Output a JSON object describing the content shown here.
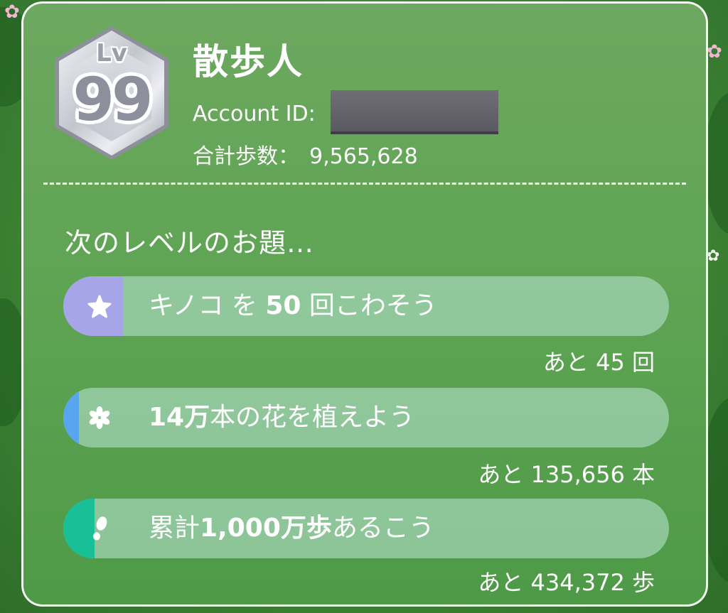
{
  "profile": {
    "level_label": "Lv",
    "level_value": "99",
    "name": "散歩人",
    "account_id_label": "Account ID:",
    "total_steps_label": "合計歩数：",
    "total_steps_value": "9,565,628"
  },
  "next_level": {
    "title": "次のレベルのお題…",
    "tasks": [
      {
        "icon": "star-icon",
        "accent_color": "#a5a5e8",
        "pre": "キノコ を ",
        "bold": "50",
        "post": " 回こわそう",
        "remaining": "あと 45 回"
      },
      {
        "icon": "flower-icon",
        "accent_color": "#5aa5f0",
        "pre": "",
        "bold": "14万",
        "post": "本の花を植えよう",
        "remaining": "あと 135,656 本"
      },
      {
        "icon": "footprint-icon",
        "accent_color": "#18bf97",
        "pre": "累計",
        "bold": "1,000万歩",
        "post": "あるこう",
        "remaining": "あと 434,372 歩"
      }
    ]
  }
}
